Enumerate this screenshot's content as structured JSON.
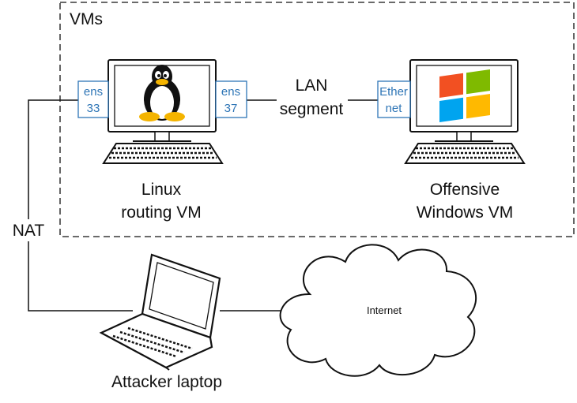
{
  "group": {
    "label": "VMs"
  },
  "linux_vm": {
    "label_line1": "Linux",
    "label_line2": "routing VM",
    "iface_left": {
      "line1": "ens",
      "line2": "33"
    },
    "iface_right": {
      "line1": "ens",
      "line2": "37"
    }
  },
  "windows_vm": {
    "label_line1": "Offensive",
    "label_line2": "Windows VM",
    "iface": {
      "line1": "Ether",
      "line2": "net"
    }
  },
  "links": {
    "lan": {
      "line1": "LAN",
      "line2": "segment"
    },
    "nat": "NAT"
  },
  "laptop": {
    "label": "Attacker laptop"
  },
  "cloud": {
    "label": "Internet"
  },
  "icons": [
    "tux-logo-icon",
    "windows-logo-icon",
    "monitor-icon",
    "keyboard-icon",
    "laptop-icon",
    "cloud-icon"
  ],
  "colors": {
    "interface_border": "#2e75b6",
    "line": "#111111"
  }
}
